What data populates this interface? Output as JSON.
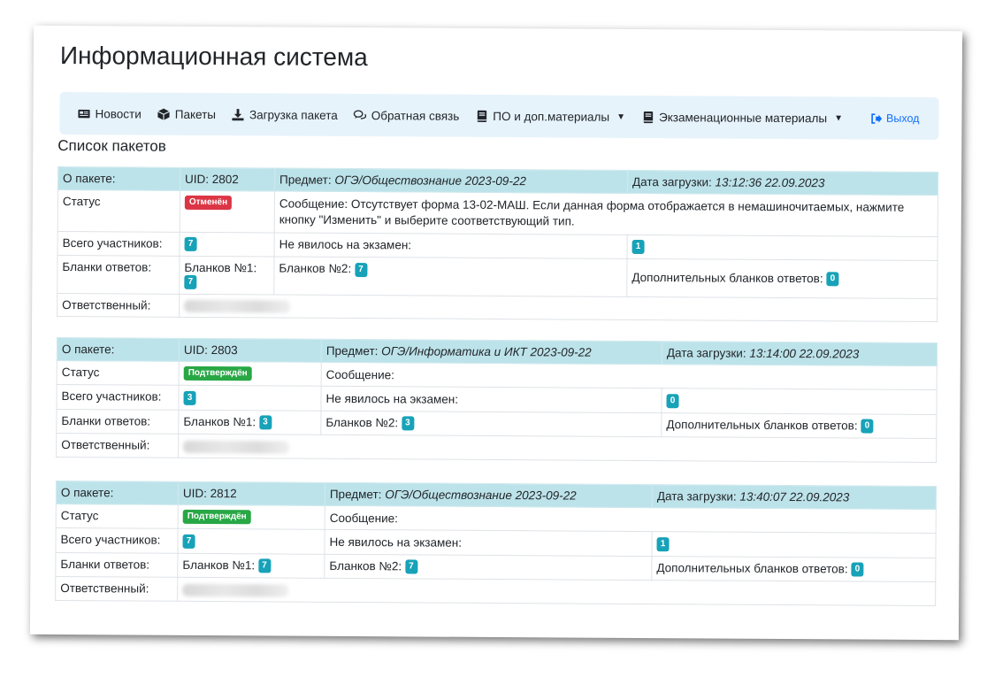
{
  "app_title": "Информационная система",
  "nav": {
    "items": [
      {
        "label": "Новости",
        "icon": "newspaper-icon"
      },
      {
        "label": "Пакеты",
        "icon": "box-icon"
      },
      {
        "label": "Загрузка пакета",
        "icon": "download-icon"
      },
      {
        "label": "Обратная связь",
        "icon": "comments-icon"
      },
      {
        "label": "ПО и доп.материалы",
        "icon": "book-icon",
        "dropdown": true
      },
      {
        "label": "Экзаменационные материалы",
        "icon": "book-icon",
        "dropdown": true
      }
    ],
    "logout_label": "Выход"
  },
  "list_title": "Список пакетов",
  "labels": {
    "about": "О пакете:",
    "status": "Статус",
    "participants": "Всего участников:",
    "answer_sheets": "Бланки ответов:",
    "responsible": "Ответственный:",
    "subject": "Предмет:",
    "upload_date": "Дата загрузки:",
    "message": "Сообщение:",
    "absent": "Не явилось на экзамен:",
    "sheets1": "Бланков №1:",
    "sheets2": "Бланков №2:",
    "extra_sheets": "Дополнительных бланков ответов:"
  },
  "packages": [
    {
      "uid": "UID: 2802",
      "subject": "ОГЭ/Обществознание 2023-09-22",
      "upload_date": "13:12:36 22.09.2023",
      "status": "Отменён",
      "status_color": "#dc3545",
      "message": "Сообщение: Отсутствует форма 13-02-МАШ. Если данная форма отображается в немашиночитаемых, нажмите кнопку \"Изменить\" и выберите соответствующий тип.",
      "participants": "7",
      "absent": "1",
      "sheets1": "7",
      "sheets2": "7",
      "extra_sheets": "0"
    },
    {
      "uid": "UID: 2803",
      "subject": "ОГЭ/Информатика и ИКТ 2023-09-22",
      "upload_date": "13:14:00 22.09.2023",
      "status": "Подтверждён",
      "status_color": "#28a745",
      "message": "Сообщение:",
      "participants": "3",
      "absent": "0",
      "sheets1": "3",
      "sheets2": "3",
      "extra_sheets": "0"
    },
    {
      "uid": "UID: 2812",
      "subject": "ОГЭ/Обществознание 2023-09-22",
      "upload_date": "13:40:07 22.09.2023",
      "status": "Подтверждён",
      "status_color": "#28a745",
      "message": "Сообщение:",
      "participants": "7",
      "absent": "1",
      "sheets1": "7",
      "sheets2": "7",
      "extra_sheets": "0"
    }
  ]
}
